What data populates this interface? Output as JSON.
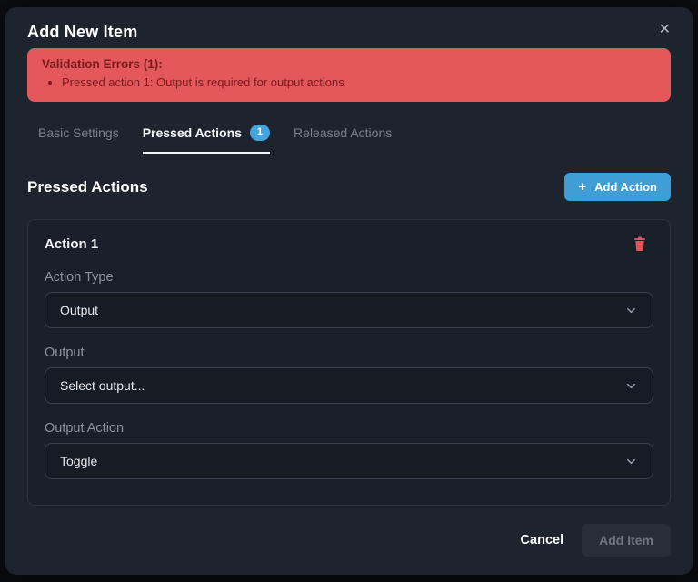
{
  "modal": {
    "title": "Add New Item",
    "close_icon": "✕"
  },
  "error_banner": {
    "heading": "Validation Errors (1):",
    "items": [
      "Pressed action 1: Output is required for output actions"
    ]
  },
  "tabs": [
    {
      "label": "Basic Settings",
      "active": false
    },
    {
      "label": "Pressed Actions",
      "badge": "1",
      "active": true
    },
    {
      "label": "Released Actions",
      "active": false
    }
  ],
  "section": {
    "title": "Pressed Actions",
    "add_button_plus": "+",
    "add_button_label": "Add Action"
  },
  "action_card": {
    "title": "Action 1",
    "delete_icon": "trash-icon",
    "fields": [
      {
        "label": "Action Type",
        "value": "Output",
        "control": "select"
      },
      {
        "label": "Output",
        "value": "Select output...",
        "control": "select"
      },
      {
        "label": "Output Action",
        "value": "Toggle",
        "control": "select"
      }
    ]
  },
  "footer": {
    "cancel_label": "Cancel",
    "submit_label": "Add Item",
    "submit_disabled": true
  },
  "colors": {
    "accent_blue": "#3f9ed6",
    "badge_blue": "#46a3dc",
    "error_background": "#e4575b",
    "error_text": "#7a1b1f",
    "trash_red": "#e25558",
    "modal_background": "#1d242d",
    "card_background": "#1a2029",
    "select_background": "#161c24"
  }
}
